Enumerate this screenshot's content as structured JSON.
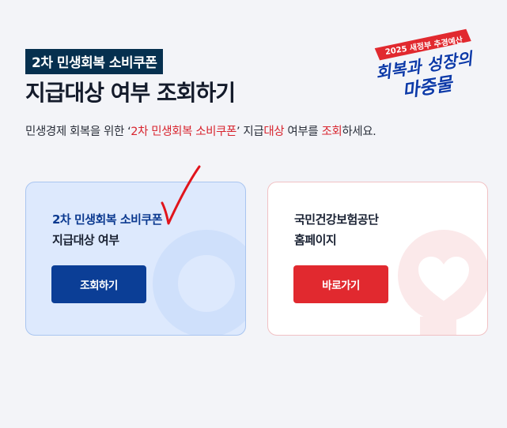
{
  "header": {
    "tag": "2차 민생회복 소비쿠폰",
    "title": "지급대상 여부 조회하기",
    "desc": {
      "part1": "민생경제 회복을 위한 ‘",
      "coupon": "2차 민생회복 소비쿠폰",
      "part2": "’ 지급",
      "target": "대상",
      "part3": " 여부를 ",
      "inquiry": "조회",
      "part4": "하세요."
    }
  },
  "stamp": {
    "banner": "2025 새정부 추경예산",
    "line1": "회복과 성장의",
    "line2": "마중물"
  },
  "cards": {
    "inquiry": {
      "line1": "2차 민생회복 소비쿠폰",
      "line2": "지급대상 여부",
      "button": "조회하기"
    },
    "nhis": {
      "line1": "국민건강보험공단",
      "line2": "홈페이지",
      "button": "바로가기"
    }
  },
  "colors": {
    "navy": "#06304f",
    "primary_blue": "#0b3e96",
    "accent_red": "#e1292f",
    "card_blue_bg": "#dde9fd"
  }
}
